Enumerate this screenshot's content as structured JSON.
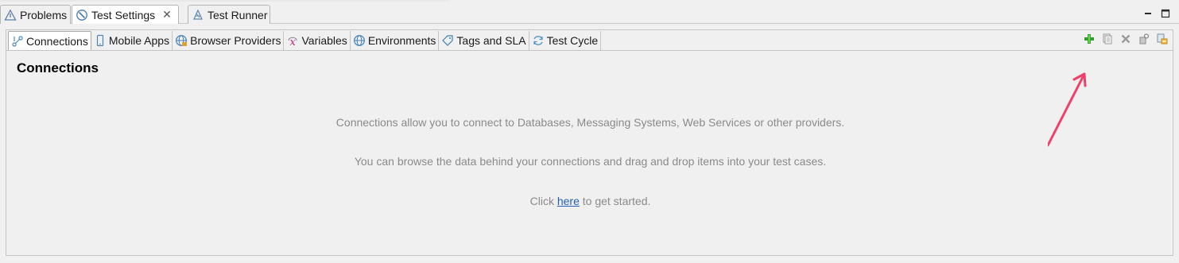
{
  "view_tabs": [
    {
      "label": "Problems",
      "icon": "problems-icon"
    },
    {
      "label": "Test Settings",
      "icon": "test-settings-icon",
      "close": "✕"
    },
    {
      "label": "Test Runner",
      "icon": "test-runner-icon"
    }
  ],
  "settings_tabs": [
    {
      "label": "Connections",
      "icon": "connections-icon"
    },
    {
      "label": "Mobile Apps",
      "icon": "mobile-icon"
    },
    {
      "label": "Browser Providers",
      "icon": "browser-globe-icon"
    },
    {
      "label": "Variables",
      "icon": "variable-x-icon"
    },
    {
      "label": "Environments",
      "icon": "globe-icon"
    },
    {
      "label": "Tags and SLA",
      "icon": "tag-icon"
    },
    {
      "label": "Test Cycle",
      "icon": "cycle-icon"
    }
  ],
  "toolbar": {
    "icons": [
      "add-icon",
      "copy-icon",
      "delete-icon",
      "edit-icon",
      "import-icon"
    ]
  },
  "content": {
    "heading": "Connections",
    "line1": "Connections allow you to connect to Databases, Messaging Systems, Web Services or other providers.",
    "line2": "You can browse the data behind your connections and drag and drop items into your test cases.",
    "line3_prefix": "Click ",
    "line3_link": "here",
    "line3_suffix": " to get started."
  },
  "colors": {
    "background": "#f0f0f0",
    "link": "#1f5fb4",
    "hint_text": "#8a8a8a",
    "arrow": "#f0406a",
    "add_green": "#2f9e2f"
  }
}
